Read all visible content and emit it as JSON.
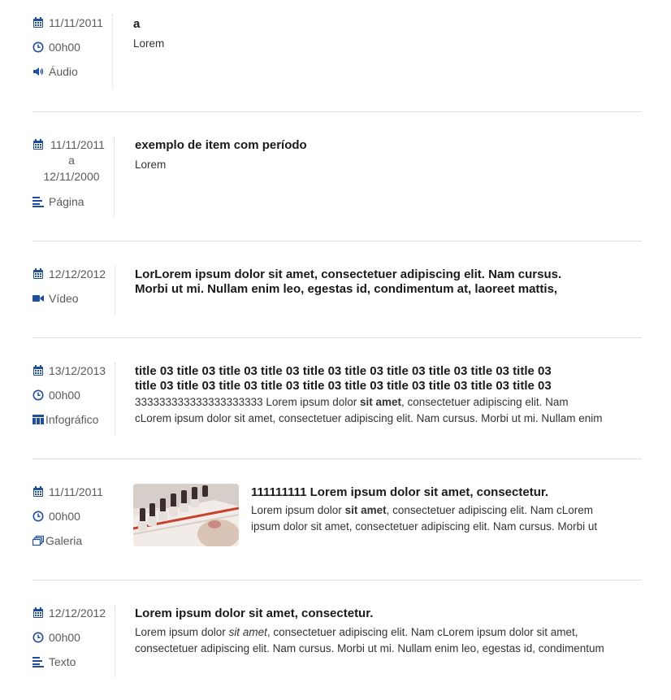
{
  "colors": {
    "icon": "#1f4e9a",
    "meta_text": "#5a5a5a",
    "divider": "#dedede"
  },
  "items": [
    {
      "date": "11/11/2011",
      "time": "00h00",
      "type_icon": "volume-icon",
      "type": "Áudio",
      "title": "a",
      "desc": "Lorem"
    },
    {
      "date": "11/11/2011",
      "date_connector": "a",
      "date_end": "12/11/2000",
      "type_icon": "align-left-icon",
      "type": "Página",
      "title": "exemplo de item com período",
      "desc": "Lorem"
    },
    {
      "date": "12/12/2012",
      "type_icon": "video-camera-icon",
      "type": "Vídeo",
      "title_line1": "LorLorem ipsum dolor sit amet, consectetuer adipiscing elit. Nam cursus.",
      "title_line2": "Morbi ut mi. Nullam enim leo, egestas id, condimentum at, laoreet mattis,"
    },
    {
      "date": "13/12/2013",
      "time": "00h00",
      "type_icon": "infographic-icon",
      "type": "Infográfico",
      "title_line1": "title 03 title 03 title 03 title 03 title 03 title 03 title 03 title 03 title 03 title 03",
      "title_line2": "title 03 title 03 title 03 title 03 title 03 title 03 title 03 title 03 title 03 title 03",
      "desc1_a": "333333333333333333333 Lorem ipsum dolor ",
      "desc1_b": "sit amet",
      "desc1_c": ", consectetuer adipiscing elit. Nam",
      "desc2": "cLorem ipsum dolor sit amet, consectetuer adipiscing elit. Nam cursus. Morbi ut mi. Nullam enim"
    },
    {
      "date": "11/11/2011",
      "time": "00h00",
      "type_icon": "gallery-icon",
      "type": "Galeria",
      "thumb_icon": "nail-polish-photo",
      "title": "111111111 Lorem ipsum dolor sit amet, consectetur.",
      "desc1_a": "Lorem ipsum dolor ",
      "desc1_b": "sit amet",
      "desc1_c": ", consectetuer adipiscing elit. Nam cLorem",
      "desc2": "ipsum dolor sit amet, consectetuer adipiscing elit. Nam cursus. Morbi ut"
    },
    {
      "date": "12/12/2012",
      "time": "00h00",
      "type_icon": "align-left-icon",
      "type": "Texto",
      "title": "Lorem ipsum dolor sit amet, consectetur.",
      "desc1_a": "Lorem ipsum dolor ",
      "desc1_b": "sit amet",
      "desc1_c": ", consectetuer adipiscing elit. Nam cLorem ipsum dolor sit amet,",
      "desc2": "consectetuer adipiscing elit. Nam cursus. Morbi ut mi. Nullam enim leo, egestas id, condimentum"
    }
  ]
}
